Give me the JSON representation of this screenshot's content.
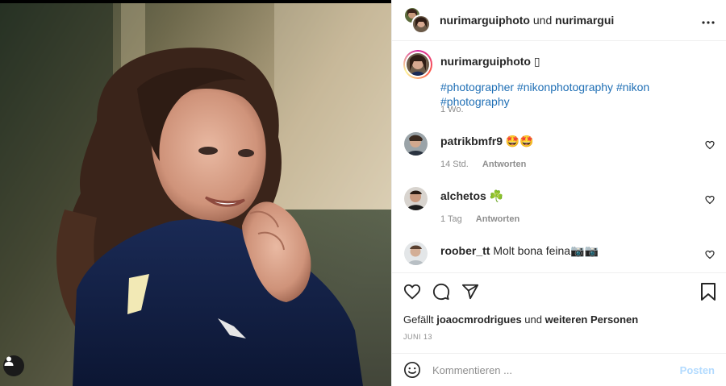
{
  "header": {
    "user1": "nurimarguiphoto",
    "connector": "und",
    "user2": "nurimargui",
    "more_icon": "more-horizontal-icon"
  },
  "caption": {
    "username": "nurimarguiphoto",
    "trail": "▯",
    "text": "#photographer #nikonphotography #nikon #photography",
    "time": "1 Wo."
  },
  "comments": [
    {
      "username": "patrikbmfr9",
      "text": "🤩🤩",
      "time": "14 Std.",
      "reply": "Antworten"
    },
    {
      "username": "alchetos",
      "text": "☘️",
      "time": "1 Tag",
      "reply": "Antworten"
    },
    {
      "username": "roober_tt",
      "text": "Molt bona feina📷📷"
    }
  ],
  "likes": {
    "prefix": "Gefällt",
    "user": "joaocmrodrigues",
    "connector": "und",
    "rest": "weiteren Personen"
  },
  "date": "JUNI 13",
  "composer": {
    "placeholder": "Kommentieren ...",
    "post_label": "Posten"
  },
  "colors": {
    "hashtag": "#1f6fb5",
    "post_button": "#b3dbff",
    "muted": "#8e8e8e"
  }
}
